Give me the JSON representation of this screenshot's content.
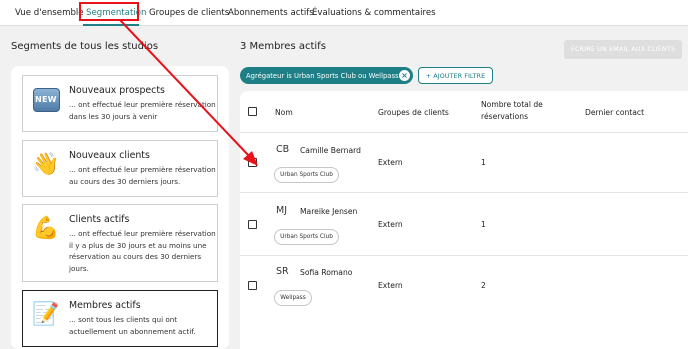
{
  "tabs": [
    {
      "label": "Vue d'ensemble"
    },
    {
      "label": "Segmentation"
    },
    {
      "label": "Groupes de clients"
    },
    {
      "label": "Abonnements actifs"
    },
    {
      "label": "Évaluations & commentaires"
    }
  ],
  "left": {
    "title": "Segments de tous les studios",
    "segments": [
      {
        "title": "Nouveaux prospects",
        "desc": "... ont effectué leur première réservation dans les 30 jours à venir",
        "icon": "new-badge-icon",
        "badge_text": "NEW"
      },
      {
        "title": "Nouveaux clients",
        "desc": "... ont effectué leur première réservation au cours des 30 derniers jours.",
        "icon": "waving-hand-icon",
        "glyph": "👋"
      },
      {
        "title": "Clients actifs",
        "desc": "... ont effectué leur première réservation il y a plus de 30 jours et au moins une réservation au cours des 30 derniers jours.",
        "icon": "flexed-biceps-icon",
        "glyph": "💪"
      },
      {
        "title": "Membres actifs",
        "desc": "... sont tous les clients qui ont actuellement un abonnement actif.",
        "icon": "memo-icon",
        "glyph": "📝"
      }
    ]
  },
  "right": {
    "title": "3 Membres actifs",
    "email_button": "ÉCRIRE UN EMAIL AUX CLIENTS",
    "filter_chip": "Agrégateur is Urban Sports Club ou Wellpass",
    "add_filter": "+ AJOUTER FILTRE",
    "columns": [
      "Nom",
      "Groupes de clients",
      "Nombre total de",
      "réservations",
      "Dernier contact"
    ],
    "rows": [
      {
        "initials": "CB",
        "name": "Camille Bernard",
        "tag": "Urban Sports Club",
        "group": "Extern",
        "total": "1",
        "last_contact": ""
      },
      {
        "initials": "MJ",
        "name": "Mareike Jensen",
        "tag": "Urban Sports Club",
        "group": "Extern",
        "total": "1",
        "last_contact": ""
      },
      {
        "initials": "SR",
        "name": "Sofia Romano",
        "tag": "Wellpass",
        "group": "Extern",
        "total": "2",
        "last_contact": ""
      }
    ]
  },
  "colors": {
    "accent": "#1e7f86",
    "highlight": "#e8121a",
    "background": "#f1f1f1"
  }
}
